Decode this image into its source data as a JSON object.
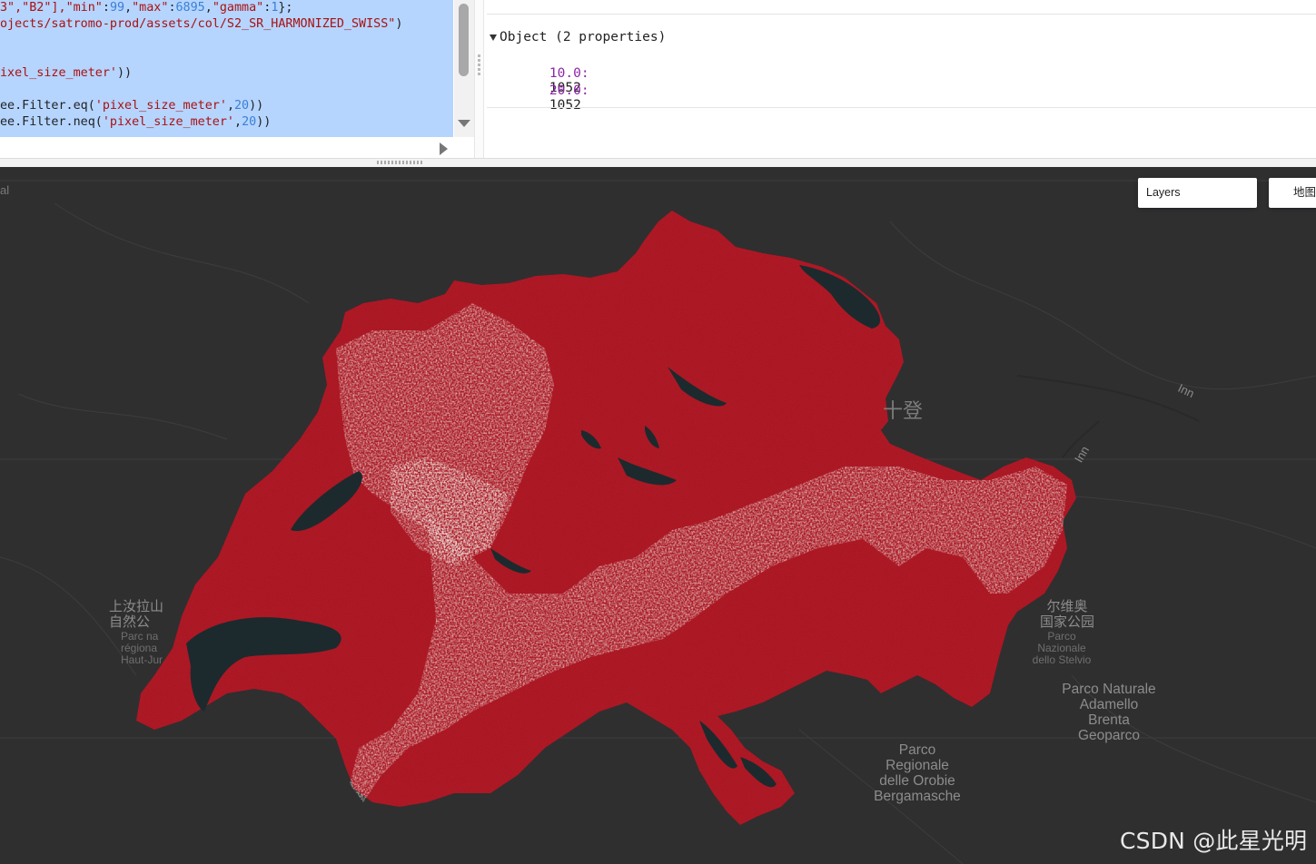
{
  "editor": {
    "code_lines": [
      [
        {
          "t": "3\",\"B2\"],",
          "c": "s"
        },
        {
          "t": "\"min\"",
          "c": "s"
        },
        {
          "t": ":",
          "c": "f"
        },
        {
          "t": "99",
          "c": "n"
        },
        {
          "t": ",",
          "c": "f"
        },
        {
          "t": "\"max\"",
          "c": "s"
        },
        {
          "t": ":",
          "c": "f"
        },
        {
          "t": "6895",
          "c": "n"
        },
        {
          "t": ",",
          "c": "f"
        },
        {
          "t": "\"gamma\"",
          "c": "s"
        },
        {
          "t": ":",
          "c": "f"
        },
        {
          "t": "1",
          "c": "n"
        },
        {
          "t": "};",
          "c": "f"
        }
      ],
      [
        {
          "t": "ojects/satromo-prod/assets/col/S2_SR_HARMONIZED_SWISS\"",
          "c": "s"
        },
        {
          "t": ")",
          "c": "f"
        }
      ],
      [],
      [],
      [
        {
          "t": "ixel_size_meter'",
          "c": "s"
        },
        {
          "t": "))",
          "c": "f"
        }
      ],
      [],
      [
        {
          "t": "ee.Filter.eq(",
          "c": "f"
        },
        {
          "t": "'pixel_size_meter'",
          "c": "s"
        },
        {
          "t": ",",
          "c": "f"
        },
        {
          "t": "20",
          "c": "n"
        },
        {
          "t": "))",
          "c": "f"
        }
      ],
      [
        {
          "t": "ee.Filter.neq(",
          "c": "f"
        },
        {
          "t": "'pixel_size_meter'",
          "c": "s"
        },
        {
          "t": ",",
          "c": "f"
        },
        {
          "t": "20",
          "c": "n"
        },
        {
          "t": "))",
          "c": "f"
        }
      ]
    ]
  },
  "console": {
    "object_header": "Object (2 properties)",
    "properties": [
      {
        "key": "10.0:",
        "value": "1052"
      },
      {
        "key": "20.0:",
        "value": "1052"
      }
    ]
  },
  "map": {
    "layers_label": "Layers",
    "maptype_label": "地图",
    "place_labels": {
      "edge_al": "al",
      "shidoeng": "十登",
      "inn1": "Inn",
      "inn2": "Inn",
      "jura_cn1": "上汝拉山",
      "jura_cn2": "自然公",
      "jura_fr1": "Parc na",
      "jura_fr2": "régiona",
      "jura_fr3": "Haut-Jur",
      "stelvio_cn1": "尔维奥",
      "stelvio_cn2": "国家公园",
      "stelvio_1": "Parco",
      "stelvio_2": "Nazionale",
      "stelvio_3": "dello Stelvio",
      "adamello_1": "Parco Naturale",
      "adamello_2": "Adamello",
      "adamello_3": "Brenta",
      "adamello_4": "Geoparco",
      "orobie_1": "Parco",
      "orobie_2": "Regionale",
      "orobie_3": "delle Orobie",
      "orobie_4": "Bergamasche"
    }
  },
  "watermark": "CSDN @此星光明",
  "colors": {
    "map_background": "#2f2f30",
    "imagery_red": "#b0161e",
    "snow": "#ded6cc",
    "lake": "#1c2a2e",
    "property_key": "#8e24aa"
  }
}
